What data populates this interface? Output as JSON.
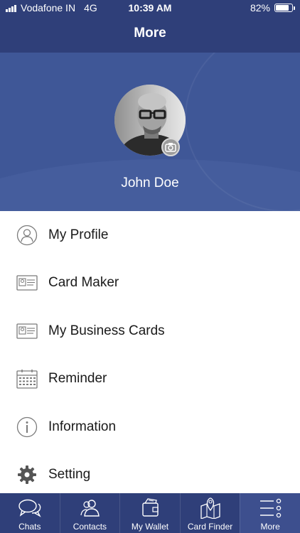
{
  "status_bar": {
    "carrier": "Vodafone IN",
    "network": "4G",
    "time": "10:39 AM",
    "battery_text": "82%",
    "battery_level": 0.82
  },
  "nav": {
    "title": "More"
  },
  "profile": {
    "name": "John Doe"
  },
  "menu": {
    "items": [
      {
        "label": "My Profile",
        "icon": "user-circle-icon"
      },
      {
        "label": "Card Maker",
        "icon": "id-card-icon"
      },
      {
        "label": "My Business Cards",
        "icon": "id-card-icon"
      },
      {
        "label": "Reminder",
        "icon": "calendar-icon"
      },
      {
        "label": "Information",
        "icon": "info-circle-icon"
      },
      {
        "label": "Setting",
        "icon": "gear-icon"
      }
    ]
  },
  "tabs": [
    {
      "label": "Chats",
      "icon": "chat-bubbles-icon",
      "active": false
    },
    {
      "label": "Contacts",
      "icon": "contacts-icon",
      "active": false
    },
    {
      "label": "My Wallet",
      "icon": "wallet-icon",
      "active": false
    },
    {
      "label": "Card Finder",
      "icon": "map-pin-icon",
      "active": false
    },
    {
      "label": "More",
      "icon": "more-list-icon",
      "active": true
    }
  ],
  "colors": {
    "nav_background": "#2f3f79",
    "header_background": "#3f5797",
    "tab_active": "#3d4f8e"
  }
}
